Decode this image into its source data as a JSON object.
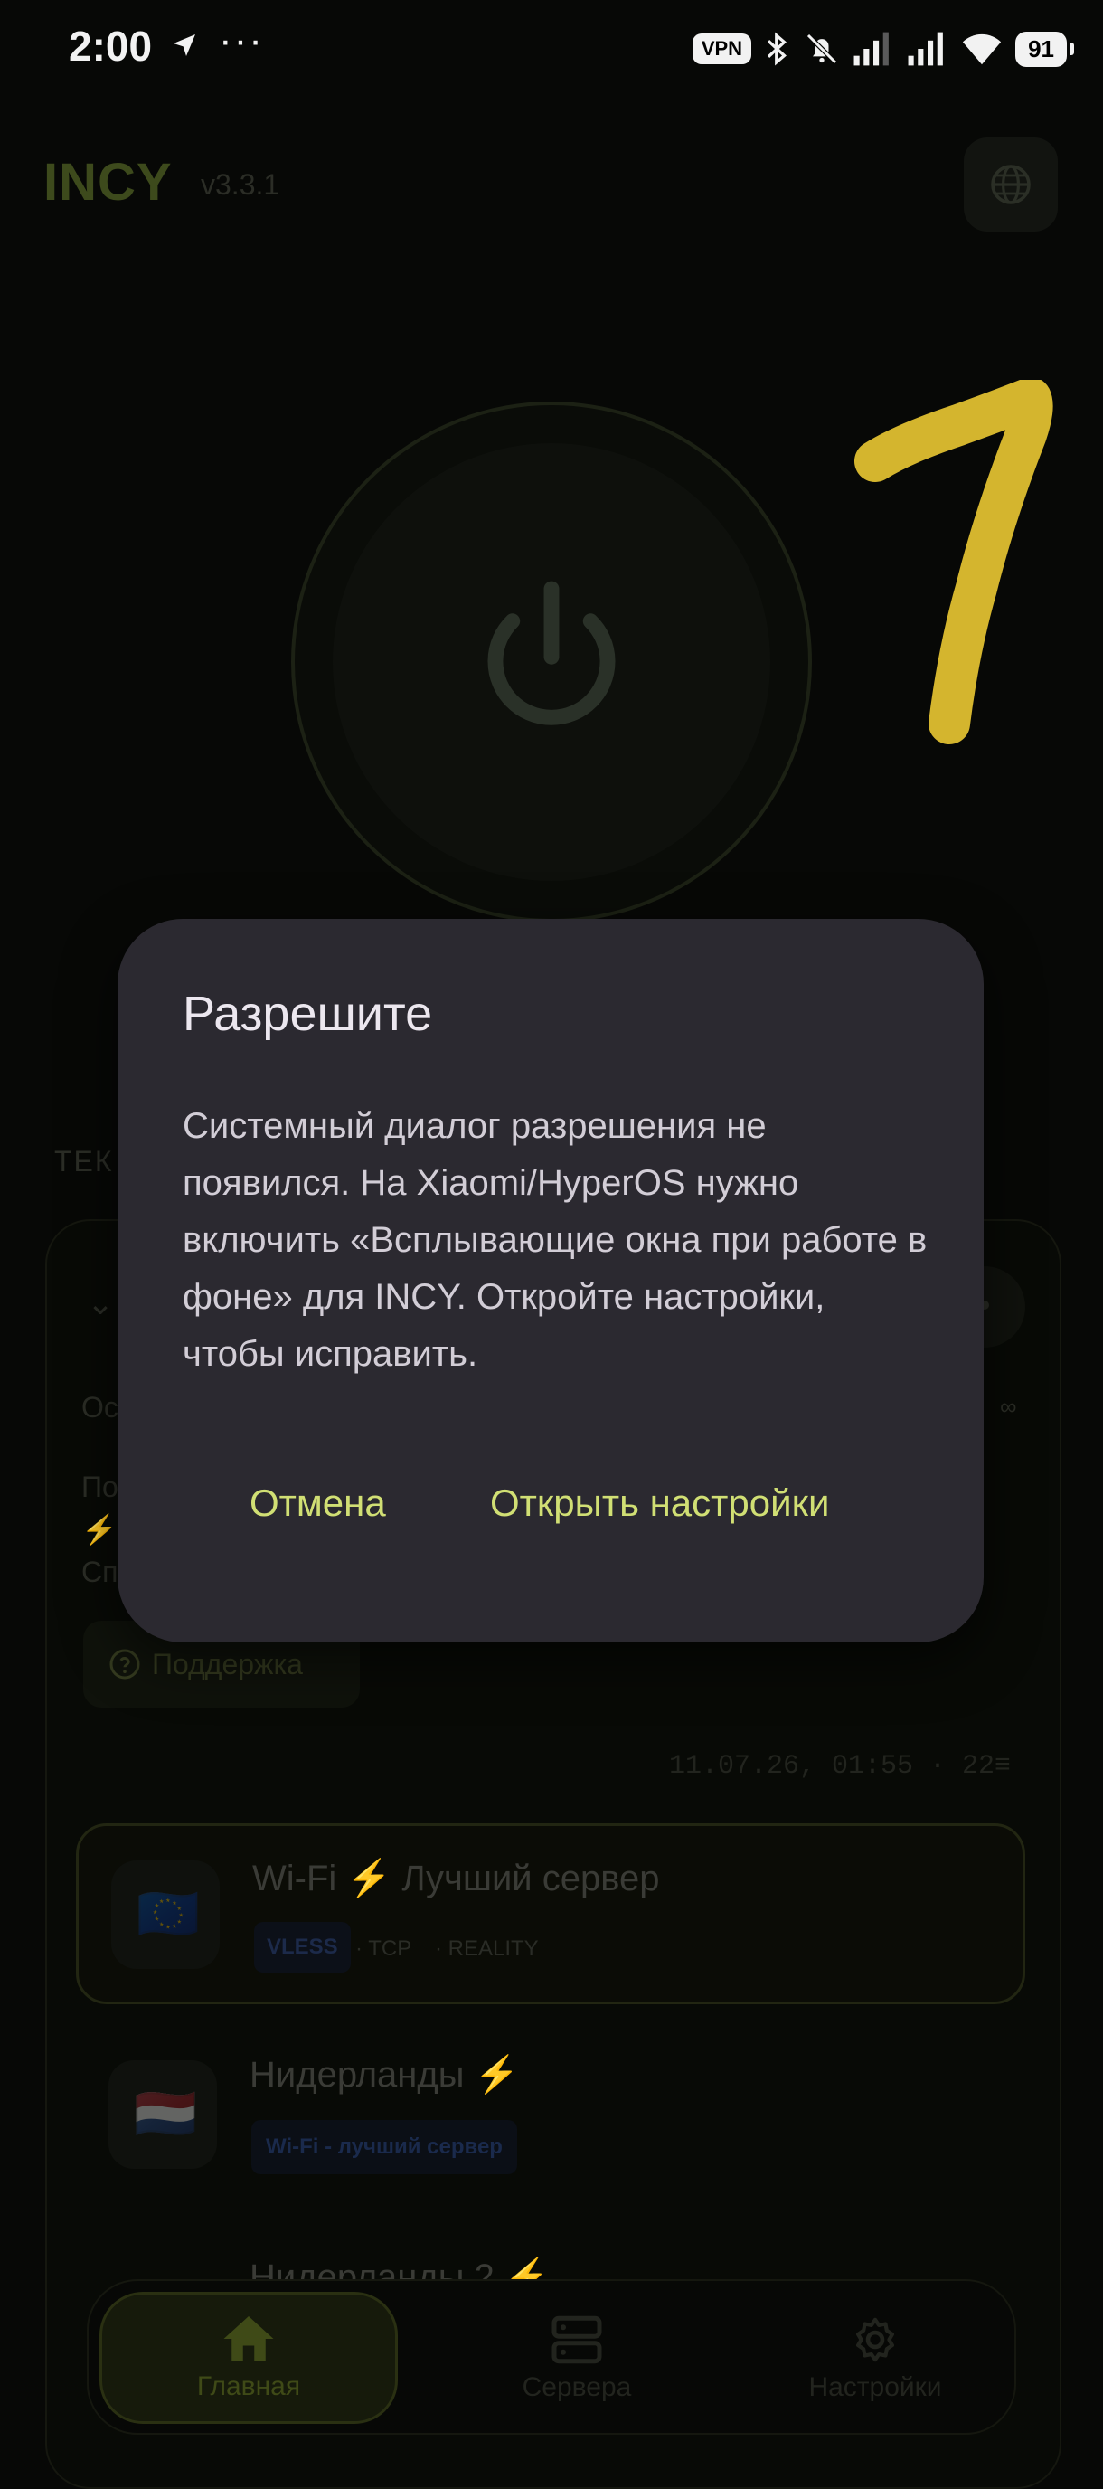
{
  "status_bar": {
    "time": "2:00",
    "dots": "···",
    "vpn": "VPN",
    "battery": "91"
  },
  "header": {
    "title": "INCY",
    "version": "v3.3.1",
    "globe_icon": "globe-icon"
  },
  "main": {
    "section_label_partial": "ТЕК",
    "info_lines": [
      "Ос",
      "По",
      "⚡",
      "Сп"
    ],
    "infinity": "∞",
    "support_button": "Поддержка",
    "timestamp": "11.07.26, 01:55  ·  22≡"
  },
  "servers": [
    {
      "flag": "🇪🇺",
      "name": "Wi-Fi ⚡ Лучший сервер",
      "protocol": "VLESS",
      "transport": "· TCP",
      "security": "· REALITY",
      "active": true
    },
    {
      "flag": "🇳🇱",
      "name": "Нидерланды ⚡",
      "tag": "Wi-Fi - лучший сервер"
    },
    {
      "name": "Нидерланды 2 ⚡"
    }
  ],
  "bottom_nav": [
    {
      "label": "Главная",
      "icon": "home-icon",
      "active": true
    },
    {
      "label": "Сервера",
      "icon": "servers-icon"
    },
    {
      "label": "Настройки",
      "icon": "gear-icon"
    }
  ],
  "dialog": {
    "title": "Разрешите",
    "body": "Системный диалог разрешения не появился. На Xiaomi/HyperOS нужно включить «Всплывающие окна при работе в фоне» для INCY. Откройте настройки, чтобы исправить.",
    "cancel_label": "Отмена",
    "open_settings_label": "Открыть настройки"
  },
  "colors": {
    "accent": "#d1df74",
    "dialog_bg": "#2b2930",
    "annotation": "#d4b52e"
  }
}
